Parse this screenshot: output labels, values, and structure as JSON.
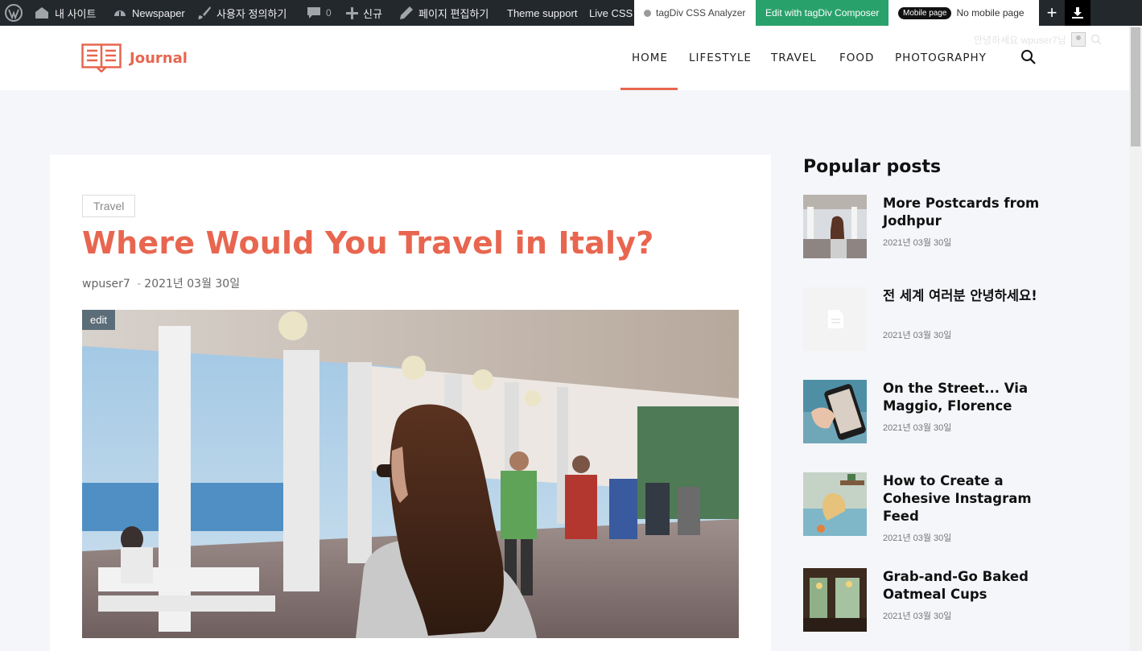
{
  "admin_bar": {
    "my_site": "내 사이트",
    "theme": "Newspaper",
    "customize": "사용자 정의하기",
    "comments_count": "0",
    "new": "신규",
    "edit_page": "페이지 편집하기",
    "theme_support": "Theme support",
    "live_css": "Live CSS",
    "css_analyzer": "tagDiv CSS Analyzer",
    "composer": "Edit with tagDiv Composer",
    "mobile_badge": "Mobile page",
    "mobile_label": "No mobile page"
  },
  "header": {
    "logo_text": "Journal",
    "greeting": "안녕하세요 wpuser7님",
    "nav": [
      "HOME",
      "LIFESTYLE",
      "TRAVEL",
      "FOOD",
      "PHOTOGRAPHY"
    ],
    "active": "HOME",
    "accent": "#e8664f"
  },
  "article": {
    "category": "Travel",
    "title": "Where Would You Travel in Italy?",
    "author": "wpuser7",
    "separator": "-",
    "date": "2021년 03월 30일",
    "edit_label": "edit"
  },
  "sidebar": {
    "title": "Popular posts",
    "posts": [
      {
        "title": "More Postcards from Jodhpur",
        "date": "2021년 03월 30일"
      },
      {
        "title": "전 세계 여러분 안녕하세요!",
        "date": "2021년 03월 30일"
      },
      {
        "title": "On the Street... Via Maggio, Florence",
        "date": "2021년 03월 30일"
      },
      {
        "title": "How to Create a Cohesive Instagram Feed",
        "date": "2021년 03월 30일"
      },
      {
        "title": "Grab-and-Go Baked Oatmeal Cups",
        "date": "2021년 03월 30일"
      }
    ]
  }
}
